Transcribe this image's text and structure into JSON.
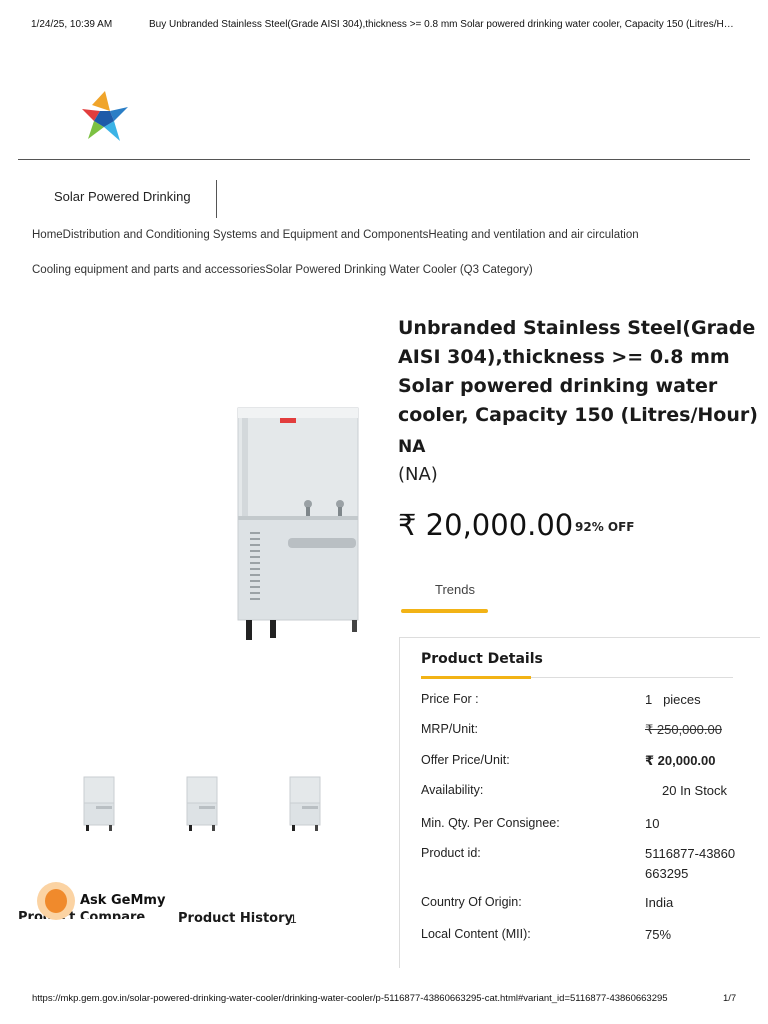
{
  "print": {
    "datetime": "1/24/25, 10:39 AM",
    "doc_title": "Buy Unbranded Stainless Steel(Grade AISI 304),thickness >= 0.8 mm Solar powered drinking water cooler, Capacity 150 (Litres/H…",
    "url": "https://mkp.gem.gov.in/solar-powered-drinking-water-cooler/drinking-water-cooler/p-5116877-43860663295-cat.html#variant_id=5116877-43860663295",
    "page": "1/7"
  },
  "category_tab": "Solar Powered Drinking",
  "breadcrumb": {
    "line1": "HomeDistribution and Conditioning Systems and Equipment and ComponentsHeating and ventilation and air circulation",
    "line2": "Cooling equipment and parts and accessoriesSolar Powered Drinking Water Cooler (Q3 Category)"
  },
  "product": {
    "title": "Unbranded Stainless Steel(Grade AISI 304),thickness >= 0.8 mm Solar powered drinking water cooler, Capacity 150 (Litres/Hour)",
    "brand": "NA",
    "brand_sub": "(NA)",
    "price": "₹ 20,000.00",
    "discount": "92% OFF"
  },
  "tabs": {
    "trends": "Trends"
  },
  "details": {
    "heading": "Product Details",
    "rows": [
      {
        "label": "Price For :",
        "value": "1   pieces"
      },
      {
        "label": "MRP/Unit:",
        "value": "₹ 250,000.00"
      },
      {
        "label": "Offer Price/Unit:",
        "value": "₹ 20,000.00"
      },
      {
        "label": "Availability:",
        "value": "20 In Stock"
      },
      {
        "label": "Min. Qty. Per Consignee:",
        "value": "10"
      },
      {
        "label": "Product id:",
        "value": "5116877-43860663295"
      },
      {
        "label": "Country Of Origin:",
        "value": "India"
      },
      {
        "label": "Local Content (MII):",
        "value": "75%"
      }
    ]
  },
  "assistant": {
    "label": "Ask GeMmy"
  },
  "bottom": {
    "compare": "Product Compare",
    "history": "Product History",
    "history_count": "1"
  },
  "colors": {
    "accent": "#f2b316",
    "cooler_body": "#e4e8ea"
  }
}
